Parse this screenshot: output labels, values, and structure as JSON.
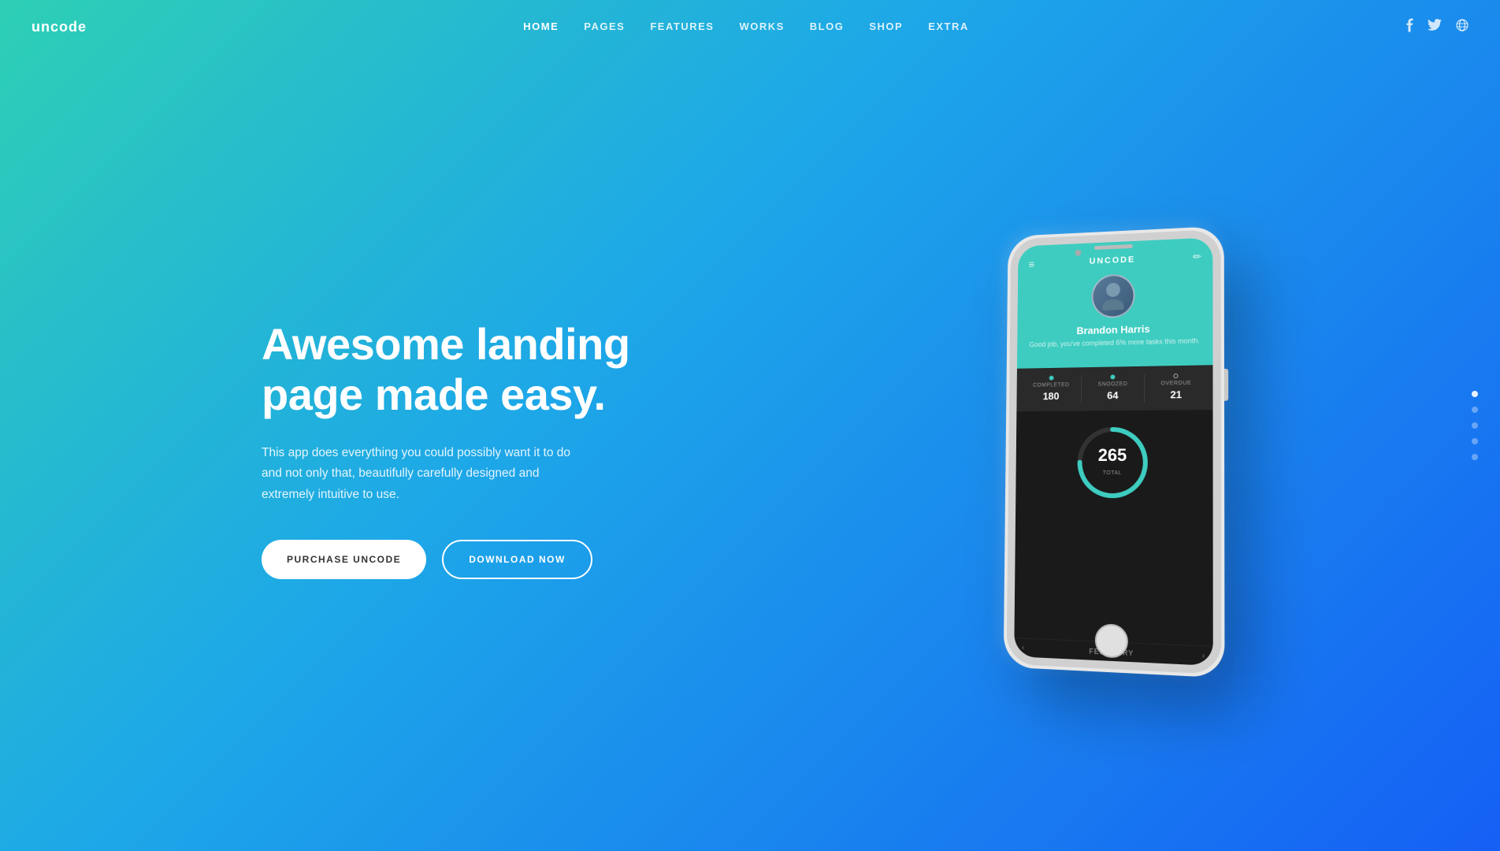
{
  "site": {
    "logo": "uncode"
  },
  "nav": {
    "links": [
      {
        "id": "home",
        "label": "HOME",
        "active": true
      },
      {
        "id": "pages",
        "label": "PAGES",
        "active": false
      },
      {
        "id": "features",
        "label": "FEATURES",
        "active": false
      },
      {
        "id": "works",
        "label": "WORKS",
        "active": false
      },
      {
        "id": "blog",
        "label": "BLOG",
        "active": false
      },
      {
        "id": "shop",
        "label": "SHOP",
        "active": false
      },
      {
        "id": "extra",
        "label": "EXTRA",
        "active": false
      }
    ],
    "social": {
      "facebook": "f",
      "twitter": "t",
      "globe": "🌐"
    }
  },
  "hero": {
    "title": "Awesome landing page made easy.",
    "subtitle": "This app does everything you could possibly want it to do and not only that, beautifully carefully designed and extremely intuitive to use.",
    "btn_primary": "PURCHASE UNCODE",
    "btn_secondary": "DOWNLOAD NOW"
  },
  "phone": {
    "app": {
      "brand": "UNCODE",
      "user_name": "Brandon Harris",
      "user_sub": "Good job, you've completed 6% more\ntasks this month.",
      "stats": [
        {
          "id": "completed",
          "label": "COMPLETED",
          "value": "180",
          "dot_color": "#3eccc0"
        },
        {
          "id": "snoozed",
          "label": "SNOOZED",
          "value": "64",
          "dot_color": "#3eccc0"
        },
        {
          "id": "overdue",
          "label": "OVERDUE",
          "value": "21",
          "dot_color": "outline"
        }
      ],
      "circle": {
        "value": "265",
        "label": "TOTAL",
        "progress_percent": 75
      },
      "month": "FEBRUARY"
    }
  },
  "scroll_dots": {
    "count": 5,
    "active_index": 0
  }
}
